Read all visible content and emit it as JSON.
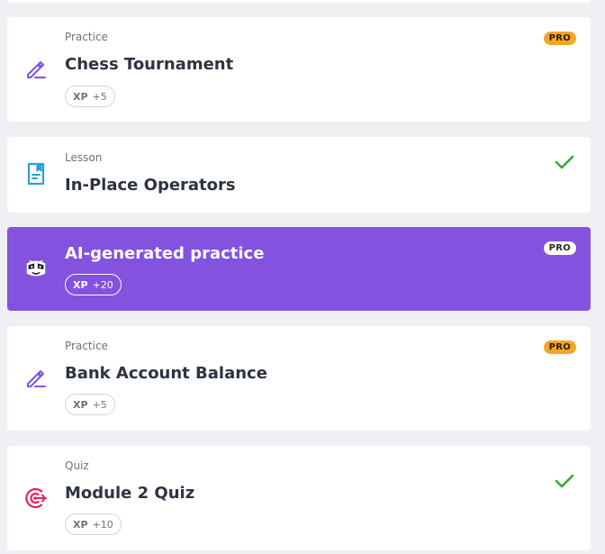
{
  "colors": {
    "background": "#eef0f4",
    "card": "#ffffff",
    "ai_card": "#8352df",
    "pro_badge": "#f5a623",
    "check": "#3ea73a",
    "practice_icon": "#8352df",
    "lesson_icon": "#2a9fd8",
    "quiz_icon": "#e0245e"
  },
  "items": [
    {
      "type": "Practice",
      "title": "Chess Tournament",
      "xp_label": "XP",
      "xp_value": "+5",
      "badge": "PRO",
      "icon": "pencil-icon"
    },
    {
      "type": "Lesson",
      "title": "In-Place Operators",
      "status": "completed",
      "icon": "lesson-book-icon"
    },
    {
      "title": "AI-generated practice",
      "xp_label": "XP",
      "xp_value": "+20",
      "badge": "PRO",
      "icon": "ai-bot-icon"
    },
    {
      "type": "Practice",
      "title": "Bank Account Balance",
      "xp_label": "XP",
      "xp_value": "+5",
      "badge": "PRO",
      "icon": "pencil-icon"
    },
    {
      "type": "Quiz",
      "title": "Module 2 Quiz",
      "xp_label": "XP",
      "xp_value": "+10",
      "status": "completed",
      "icon": "target-icon"
    }
  ]
}
